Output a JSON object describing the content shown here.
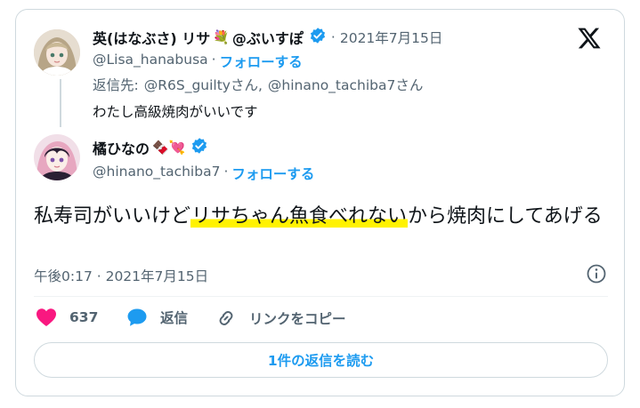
{
  "reply_tweet": {
    "display_name": "英(はなぶさ) リサ",
    "name_emoji": "💐",
    "display_name_suffix": "@ぶいすぽ",
    "date": "2021年7月15日",
    "handle": "@Lisa_hanabusa",
    "follow_label": "フォローする",
    "replying_prefix": "返信先:",
    "replying_to_1": "@R6S_guiltyさん,",
    "replying_to_2": "@hinano_tachiba7さん",
    "text": "わたし高級焼肉がいいです"
  },
  "main_tweet": {
    "display_name": "橘ひなの",
    "name_emojis": "🍫💘",
    "handle": "@hinano_tachiba7",
    "follow_label": "フォローする",
    "text_before": "私寿司がいいけど",
    "text_highlight": "リサちゃん魚食べれない",
    "text_after": "から焼肉にしてあげる",
    "timestamp": "午後0:17 · 2021年7月15日"
  },
  "actions": {
    "like_count": "637",
    "reply_label": "返信",
    "copy_link_label": "リンクをコピー"
  },
  "read_replies_label": "1件の返信を読む",
  "separator": "·",
  "icons": {
    "platform": "x-logo-icon",
    "verified": "verified-badge-icon",
    "info": "info-icon",
    "like": "heart-icon",
    "reply": "speech-bubble-icon",
    "link": "link-icon"
  },
  "colors": {
    "link_blue": "#1d9bf0",
    "like_pink": "#f91880",
    "highlight": "#fff200",
    "muted_gray": "#536471"
  }
}
